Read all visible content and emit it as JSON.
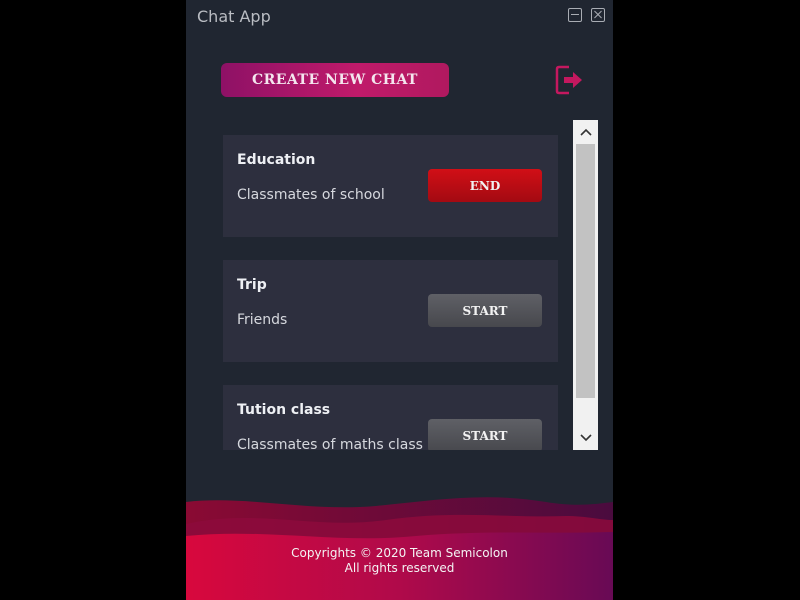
{
  "app": {
    "title": "Chat App"
  },
  "toolbar": {
    "create_label": "CREATE NEW CHAT",
    "logout_icon": "logout-icon"
  },
  "chats": [
    {
      "title": "Education",
      "description": "Classmates of school",
      "action": "END"
    },
    {
      "title": "Trip",
      "description": "Friends",
      "action": "START"
    },
    {
      "title": "Tution class",
      "description": "Classmates of maths class",
      "action": "START"
    }
  ],
  "footer": {
    "line1": "Copyrights © 2020 Team Semicolon",
    "line2": "All rights reserved"
  },
  "colors": {
    "window_bg": "#202631",
    "card_bg": "#2d2f3e",
    "accent": "#c01a6a",
    "end_button": "#d10f16",
    "start_button": "#55565c"
  }
}
